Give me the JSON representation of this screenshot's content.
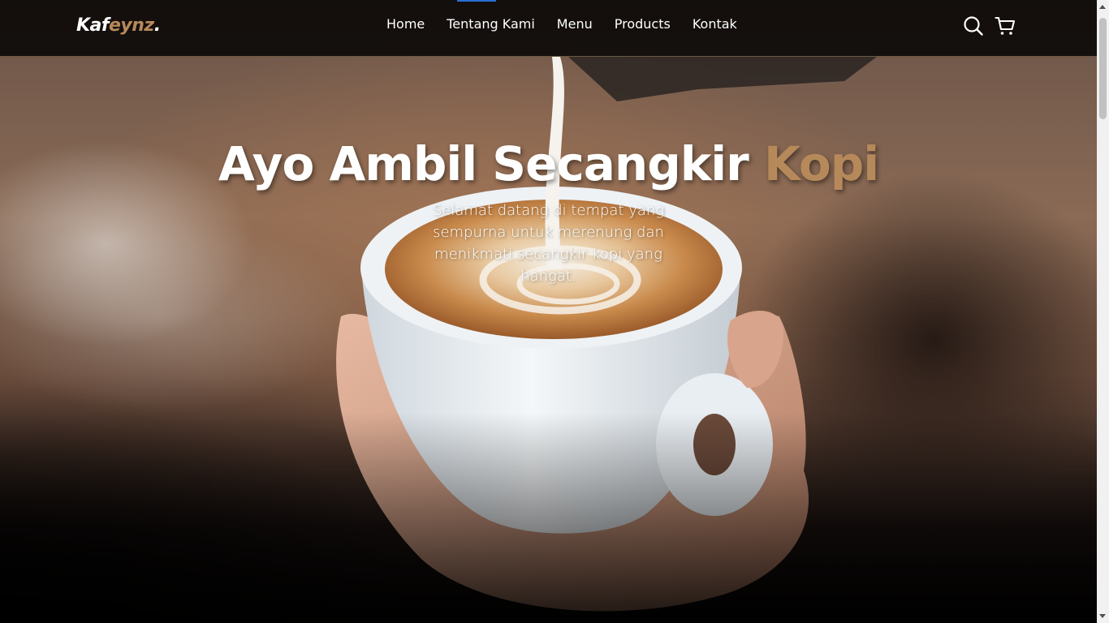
{
  "brand": {
    "part1": "Kaf",
    "part2": "eynz",
    "dot": ".",
    "accent_color": "#b6895b"
  },
  "nav": {
    "links": [
      "Home",
      "Tentang Kami",
      "Menu",
      "Products",
      "Kontak"
    ]
  },
  "icons": {
    "search": "search-icon",
    "cart": "shopping-cart-icon"
  },
  "hero": {
    "title_main": "Ayo Ambil Secangkir ",
    "title_accent": "Kopi",
    "subtitle": "Selamat datang di tempat yang sempurna untuk merenung dan menikmati secangkir kopi yang hangat.",
    "image": "latte-art-coffee-cup"
  }
}
